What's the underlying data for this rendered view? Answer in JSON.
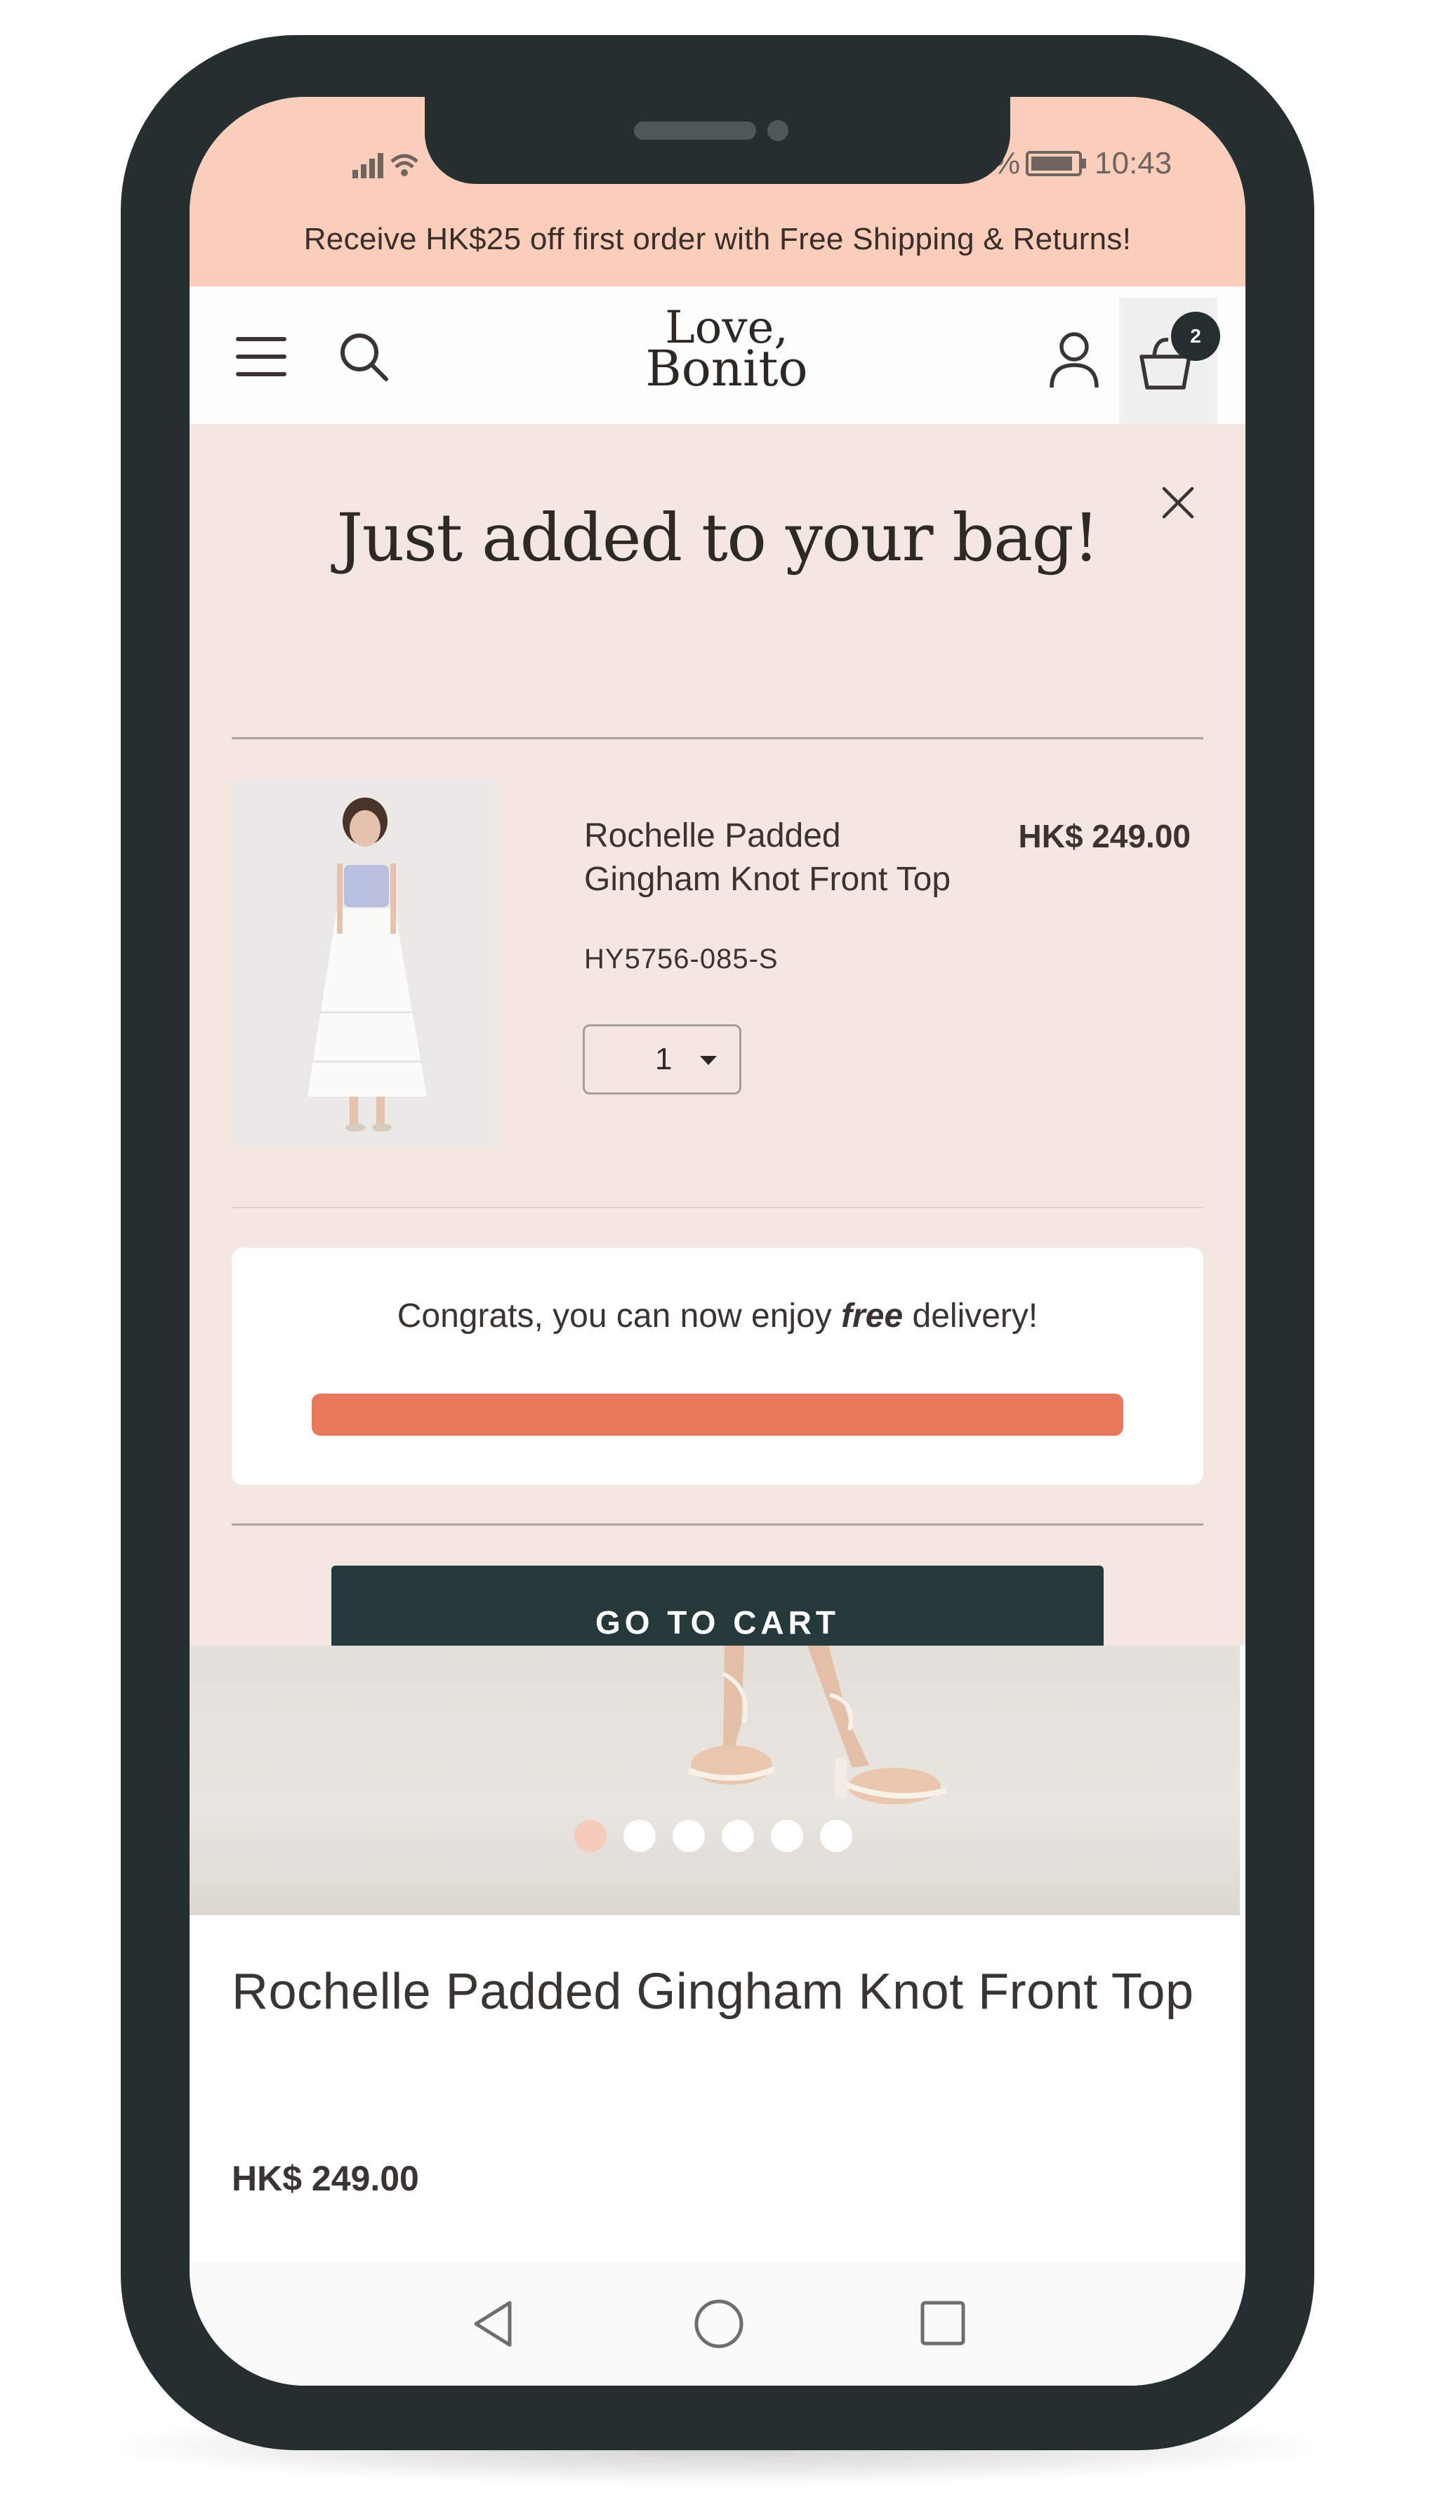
{
  "status_bar": {
    "battery_percent_fragment": "%",
    "time": "10:43"
  },
  "promo_banner": {
    "text": "Receive HK$25 off first order with Free Shipping & Returns!"
  },
  "header": {
    "logo_line1": "Love,",
    "logo_line2": "Bonito",
    "cart_count": "2"
  },
  "added_modal": {
    "title": "Just added to your bag!",
    "item": {
      "name_line1": "Rochelle Padded",
      "name_line2": "Gingham Knot Front Top",
      "price": "HK$ 249.00",
      "sku": "HY5756-085-S",
      "quantity": "1"
    },
    "shipping_progress": {
      "text_before": "Congrats, you can now enjoy ",
      "text_emphasis": "free",
      "text_after": " delivery!",
      "progress_fraction": 1.0,
      "fill_color": "#e8785c"
    },
    "cta_label": "GO TO CART"
  },
  "product_gallery": {
    "slide_count": 6,
    "active_index": 0
  },
  "product": {
    "title": "Rochelle Padded Gingham Knot Front Top",
    "price": "HK$ 249.00"
  },
  "colors": {
    "brand_dark": "#26393a",
    "promo_peach": "#fbcdbb",
    "modal_bg": "#f4e7e2",
    "progress_orange": "#e8785c"
  },
  "icons": [
    "menu-icon",
    "search-icon",
    "account-icon",
    "shopping-bag-icon",
    "close-icon",
    "caret-down-icon",
    "back-icon",
    "home-icon",
    "recents-icon",
    "signal-icon",
    "wifi-icon",
    "battery-icon"
  ]
}
